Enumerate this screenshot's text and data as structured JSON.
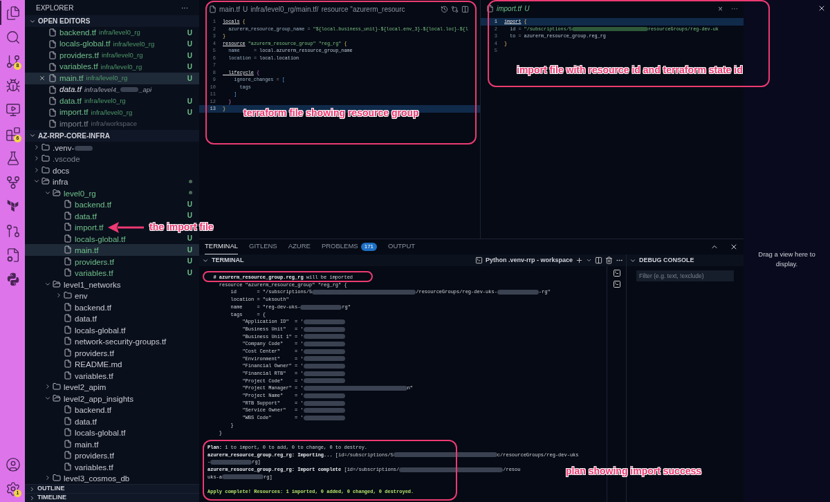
{
  "activity_bar": {
    "items": [
      {
        "kind": "explorer",
        "selected": true
      },
      {
        "kind": "search",
        "selected": false
      },
      {
        "kind": "source-control",
        "selected": false,
        "badge": "8"
      },
      {
        "kind": "run-debug",
        "selected": false
      },
      {
        "kind": "remote",
        "selected": false
      },
      {
        "kind": "extensions",
        "selected": false,
        "badge": "6"
      },
      {
        "kind": "testing",
        "selected": false
      },
      {
        "kind": "git-graph",
        "selected": false
      },
      {
        "kind": "terraform",
        "selected": false
      },
      {
        "kind": "gitlens",
        "selected": false
      },
      {
        "kind": "file-settings",
        "selected": false
      },
      {
        "kind": "python",
        "selected": false
      }
    ],
    "bottom": [
      {
        "kind": "account"
      },
      {
        "kind": "settings",
        "badge": "1"
      }
    ]
  },
  "explorer": {
    "title": "EXPLORER",
    "more": "···",
    "open_editors": {
      "title": "OPEN EDITORS",
      "expanded": true,
      "items": [
        {
          "name": "backend.tf",
          "path": "infra/level0_rg",
          "status": "U",
          "selected": false,
          "preview": false,
          "dimmed": false
        },
        {
          "name": "locals-global.tf",
          "path": "infra/level0_rg",
          "status": "U",
          "selected": false,
          "preview": false,
          "dimmed": false
        },
        {
          "name": "providers.tf",
          "path": "infra/level0_rg",
          "status": "U",
          "selected": false,
          "preview": false,
          "dimmed": false
        },
        {
          "name": "variables.tf",
          "path": "infra/level0_rg",
          "status": "U",
          "selected": false,
          "preview": false,
          "dimmed": false
        },
        {
          "name": "main.tf",
          "path": "infra/level0_rg",
          "status": "U",
          "selected": true,
          "preview": false,
          "dimmed": false
        },
        {
          "name": "data.tf",
          "path": [
            "infra/level4_",
            {
              "kind": "redacted"
            },
            "_api"
          ],
          "selected": false,
          "preview": true,
          "dimmed": false
        },
        {
          "name": "data.tf",
          "path": "infra/level0_rg",
          "status": "U",
          "selected": false,
          "preview": false,
          "dimmed": false
        },
        {
          "name": "import.tf",
          "path": "infra/level0_rg",
          "status": "U",
          "selected": false,
          "preview": false,
          "dimmed": false
        },
        {
          "name": "import.tf",
          "path": "infra/workspace",
          "selected": false,
          "preview": false,
          "dimmed": true
        }
      ]
    },
    "workspace": {
      "title": "AZ-RRP-CORE-INFRA",
      "expanded": true,
      "tree": [
        {
          "kind": "folder",
          "name": [
            ".venv-",
            {
              "kind": "redacted"
            }
          ],
          "expanded": false,
          "dimmed": false
        },
        {
          "kind": "folder",
          "name": ".vscode",
          "expanded": false,
          "dimmed": true
        },
        {
          "kind": "folder",
          "name": "docs",
          "expanded": false,
          "dimmed": false
        },
        {
          "kind": "folder",
          "name": "infra",
          "expanded": true,
          "dimmed": false,
          "has_changes": true,
          "children": [
            {
              "kind": "folder",
              "name": "level0_rg",
              "expanded": true,
              "untracked": true,
              "has_changes": true,
              "children": [
                {
                  "kind": "file",
                  "name": "backend.tf",
                  "status": "U",
                  "selected": false
                },
                {
                  "kind": "file",
                  "name": "data.tf",
                  "status": "U",
                  "selected": false
                },
                {
                  "kind": "file",
                  "name": "import.tf",
                  "untracked": true,
                  "selected": false
                },
                {
                  "kind": "file",
                  "name": "locals-global.tf",
                  "status": "U",
                  "selected": false
                },
                {
                  "kind": "file",
                  "name": "main.tf",
                  "status": "U",
                  "selected": true
                },
                {
                  "kind": "file",
                  "name": "providers.tf",
                  "status": "U",
                  "selected": false
                },
                {
                  "kind": "file",
                  "name": "variables.tf",
                  "status": "U",
                  "selected": false
                }
              ]
            },
            {
              "kind": "folder",
              "name": "level1_networks",
              "expanded": true,
              "children": [
                {
                  "kind": "folder",
                  "name": "env",
                  "expanded": false
                },
                {
                  "kind": "file",
                  "name": "backend.tf",
                  "selected": false
                },
                {
                  "kind": "file",
                  "name": "data.tf",
                  "selected": false
                },
                {
                  "kind": "file",
                  "name": "locals-global.tf",
                  "selected": false
                },
                {
                  "kind": "file",
                  "name": "network-security-groups.tf",
                  "selected": false
                },
                {
                  "kind": "file",
                  "name": "providers.tf",
                  "selected": false
                },
                {
                  "kind": "file",
                  "name": "README.md",
                  "selected": false
                },
                {
                  "kind": "file",
                  "name": "variables.tf",
                  "selected": false
                }
              ]
            },
            {
              "kind": "folder",
              "name": "level2_apim",
              "expanded": false
            },
            {
              "kind": "folder",
              "name": "level2_app_insights",
              "expanded": true,
              "children": [
                {
                  "kind": "file",
                  "name": "backend.tf",
                  "selected": false
                },
                {
                  "kind": "file",
                  "name": "data.tf",
                  "selected": false
                },
                {
                  "kind": "file",
                  "name": "locals-global.tf",
                  "selected": false
                },
                {
                  "kind": "file",
                  "name": "main.tf",
                  "selected": false
                },
                {
                  "kind": "file",
                  "name": "providers.tf",
                  "selected": false
                },
                {
                  "kind": "file",
                  "name": "variables.tf",
                  "selected": false
                }
              ]
            },
            {
              "kind": "folder",
              "name": "level3_cosmos_db",
              "expanded": false
            }
          ]
        }
      ]
    },
    "outline": {
      "title": "OUTLINE",
      "expanded": false
    },
    "timeline": {
      "title": "TIMELINE",
      "expanded": false
    }
  },
  "editors": [
    {
      "tab": {
        "name": "main.tf",
        "status": "U",
        "breadcrumb": "infra/level0_rg/main.tf/",
        "symbol": "resource \"azurerm_resourc"
      },
      "lines": [
        {
          "number": "1",
          "current": false,
          "tokens": [
            {
              "kind": "kw",
              "text": "locals"
            },
            {
              "kind": "y",
              "text": " {"
            }
          ]
        },
        {
          "number": "2",
          "current": false,
          "tokens": [
            {
              "kind": "attr",
              "text": "  azurerm_resource_group_name"
            },
            {
              "kind": "op",
              "text": " = "
            },
            {
              "kind": "str",
              "text": "\"${local.business_unit}-${local.env_3}-${local.loc}-${l"
            }
          ]
        },
        {
          "number": "3",
          "current": false,
          "tokens": [
            {
              "kind": "y",
              "text": "}"
            }
          ]
        },
        {
          "number": "4",
          "current": false,
          "tokens": [
            {
              "kind": "kw",
              "text": "resource"
            },
            {
              "kind": "str",
              "text": " \"azurerm_resource_group\" \"reg_rg\""
            },
            {
              "kind": "y",
              "text": " {"
            }
          ]
        },
        {
          "number": "5",
          "current": false,
          "tokens": [
            {
              "kind": "attr",
              "text": "  name     "
            },
            {
              "kind": "op",
              "text": "= "
            },
            {
              "kind": "id",
              "text": "local.azurerm_resource_group_name"
            }
          ]
        },
        {
          "number": "6",
          "current": false,
          "tokens": [
            {
              "kind": "attr",
              "text": "  location "
            },
            {
              "kind": "op",
              "text": "= "
            },
            {
              "kind": "id",
              "text": "local.location"
            }
          ]
        },
        {
          "number": "7",
          "current": false
        },
        {
          "number": "8",
          "current": false,
          "tokens": [
            {
              "kind": "kw",
              "text": "  lifecycle"
            },
            {
              "kind": "p",
              "text": " {"
            }
          ]
        },
        {
          "number": "9",
          "current": false,
          "tokens": [
            {
              "kind": "attr",
              "text": "    ignore_changes"
            },
            {
              "kind": "op",
              "text": " = "
            },
            {
              "kind": "b",
              "text": "["
            }
          ]
        },
        {
          "number": "10",
          "current": false,
          "tokens": [
            {
              "kind": "attr",
              "text": "      tags"
            }
          ]
        },
        {
          "number": "11",
          "current": false,
          "tokens": [
            {
              "kind": "b",
              "text": "    ]"
            }
          ]
        },
        {
          "number": "12",
          "current": false,
          "tokens": [
            {
              "kind": "p",
              "text": "  }"
            }
          ]
        },
        {
          "number": "13",
          "current": true,
          "tokens": [
            {
              "kind": "y",
              "text": "}"
            }
          ]
        }
      ]
    },
    {
      "tab": {
        "name": "import.tf",
        "status": "U",
        "close": "×",
        "more": "···"
      },
      "lines": [
        {
          "number": "1",
          "current": true,
          "tokens": [
            {
              "kind": "kw",
              "text": "import"
            },
            {
              "kind": "y",
              "text": " {"
            }
          ]
        },
        {
          "number": "2",
          "current": false,
          "tokens": [
            {
              "kind": "attr",
              "text": "  id"
            },
            {
              "kind": "op",
              "text": " = "
            },
            {
              "kind": "str",
              "text": "\"/subscriptions/5"
            },
            {
              "kind": "redacted"
            },
            {
              "kind": "str",
              "text": "resourceGroups/reg-dev-uk"
            }
          ]
        },
        {
          "number": "3",
          "current": false,
          "tokens": [
            {
              "kind": "attr",
              "text": "  to"
            },
            {
              "kind": "op",
              "text": " = "
            },
            {
              "kind": "id",
              "text": "azurerm_resource_group.reg_rg"
            }
          ]
        },
        {
          "number": "4",
          "current": false,
          "tokens": [
            {
              "kind": "y",
              "text": "}"
            }
          ]
        },
        {
          "number": "5",
          "current": false
        }
      ]
    }
  ],
  "panel": {
    "tabs": [
      {
        "label": "TERMINAL",
        "selected": true
      },
      {
        "label": "GITLENS",
        "selected": false
      },
      {
        "label": "AZURE",
        "selected": false
      },
      {
        "label": "PROBLEMS",
        "selected": false,
        "badge": "171"
      },
      {
        "label": "OUTPUT",
        "selected": false
      }
    ],
    "terminal": {
      "title": "TERMINAL",
      "profile": "Python .venv-rrp - workspace",
      "lines": [
        {
          "kind": "text",
          "segments": [
            {
              "kind": "bold",
              "text": "  # azurerm_resource_group.reg_rg"
            },
            {
              "kind": "plain",
              "text": " will be imported"
            }
          ]
        },
        {
          "kind": "text",
          "segments": [
            {
              "kind": "plain",
              "text": "    resource \"azurerm_resource_group\" \"reg_rg\" {"
            }
          ]
        },
        {
          "kind": "text",
          "segments": [
            {
              "kind": "plain",
              "text": "        id       = \"/subscriptions/5"
            },
            {
              "kind": "redacted-long"
            },
            {
              "kind": "plain",
              "text": "/resourceGroups/reg-dev-uks-"
            },
            {
              "kind": "redacted"
            },
            {
              "kind": "plain",
              "text": "-rg\""
            }
          ]
        },
        {
          "kind": "text",
          "segments": [
            {
              "kind": "plain",
              "text": "        location = \"uksouth\""
            }
          ]
        },
        {
          "kind": "text",
          "segments": [
            {
              "kind": "plain",
              "text": "        name     = \"reg-dev-uks-"
            },
            {
              "kind": "redacted"
            },
            {
              "kind": "plain",
              "text": "rg\""
            }
          ]
        },
        {
          "kind": "text",
          "segments": [
            {
              "kind": "plain",
              "text": "        tags     = {"
            }
          ]
        },
        {
          "kind": "text",
          "segments": [
            {
              "kind": "plain",
              "text": "            \"Application ID\"  = '"
            },
            {
              "kind": "redacted"
            }
          ]
        },
        {
          "kind": "text",
          "segments": [
            {
              "kind": "plain",
              "text": "            \"Business Unit\"   = '"
            },
            {
              "kind": "redacted"
            }
          ]
        },
        {
          "kind": "text",
          "segments": [
            {
              "kind": "plain",
              "text": "            \"Business Unit 1\" = '"
            },
            {
              "kind": "redacted"
            }
          ]
        },
        {
          "kind": "text",
          "segments": [
            {
              "kind": "plain",
              "text": "            \"Company Code\"    = '"
            },
            {
              "kind": "redacted"
            }
          ]
        },
        {
          "kind": "text",
          "segments": [
            {
              "kind": "plain",
              "text": "            \"Cost Center\"     = '"
            },
            {
              "kind": "redacted"
            }
          ]
        },
        {
          "kind": "text",
          "segments": [
            {
              "kind": "plain",
              "text": "            \"Environment\"     = '"
            },
            {
              "kind": "redacted"
            }
          ]
        },
        {
          "kind": "text",
          "segments": [
            {
              "kind": "plain",
              "text": "            \"Financial Owner\" = '"
            },
            {
              "kind": "redacted"
            }
          ]
        },
        {
          "kind": "text",
          "segments": [
            {
              "kind": "plain",
              "text": "            \"Financial RTB\"   = '"
            },
            {
              "kind": "redacted"
            }
          ]
        },
        {
          "kind": "text",
          "segments": [
            {
              "kind": "plain",
              "text": "            \"Project Code\"    = '"
            },
            {
              "kind": "redacted"
            }
          ]
        },
        {
          "kind": "text",
          "segments": [
            {
              "kind": "plain",
              "text": "            \"Project Manager\" = '"
            },
            {
              "kind": "redacted-long"
            },
            {
              "kind": "plain",
              "text": "n\""
            }
          ]
        },
        {
          "kind": "text",
          "segments": [
            {
              "kind": "plain",
              "text": "            \"Project Name\"    = '"
            },
            {
              "kind": "redacted"
            }
          ]
        },
        {
          "kind": "text",
          "segments": [
            {
              "kind": "plain",
              "text": "            \"RTB Support\"     = '"
            },
            {
              "kind": "redacted"
            }
          ]
        },
        {
          "kind": "text",
          "segments": [
            {
              "kind": "plain",
              "text": "            \"Service Owner\"   = '"
            },
            {
              "kind": "redacted"
            }
          ]
        },
        {
          "kind": "text",
          "segments": [
            {
              "kind": "plain",
              "text": "            \"WBS Code\"        = '"
            },
            {
              "kind": "redacted"
            }
          ]
        },
        {
          "kind": "text",
          "segments": [
            {
              "kind": "plain",
              "text": "        }"
            }
          ]
        },
        {
          "kind": "text",
          "segments": [
            {
              "kind": "plain",
              "text": "    }"
            }
          ]
        },
        {
          "kind": "blank"
        },
        {
          "kind": "text",
          "segments": [
            {
              "kind": "bold",
              "text": "Plan:"
            },
            {
              "kind": "plain",
              "text": " 1 to import, 0 to add, 0 to change, 0 to destroy."
            }
          ]
        },
        {
          "kind": "text",
          "segments": [
            {
              "kind": "bold",
              "text": "azurerm_resource_group.reg_rg: Importing..."
            },
            {
              "kind": "plain",
              "text": " [id=/subscriptions/5"
            },
            {
              "kind": "redacted-long"
            },
            {
              "kind": "plain",
              "text": "c/resourceGroups/reg-dev-uks"
            }
          ]
        },
        {
          "kind": "text",
          "segments": [
            {
              "kind": "plain",
              "text": "-"
            },
            {
              "kind": "redacted"
            },
            {
              "kind": "plain",
              "text": "rg]"
            }
          ]
        },
        {
          "kind": "text",
          "segments": [
            {
              "kind": "bold",
              "text": "azurerm_resource_group.reg_rg: Import complete"
            },
            {
              "kind": "plain",
              "text": " [id=/subscriptions/"
            },
            {
              "kind": "redacted-long"
            },
            {
              "kind": "plain",
              "text": "/resou"
            }
          ]
        },
        {
          "kind": "text",
          "segments": [
            {
              "kind": "plain",
              "text": "uks-a"
            },
            {
              "kind": "redacted"
            },
            {
              "kind": "plain",
              "text": "rg]"
            }
          ]
        },
        {
          "kind": "blank"
        },
        {
          "kind": "text",
          "segments": [
            {
              "kind": "success",
              "text": "Apply complete! Resources: 1 imported, 0 added, 0 changed, 0 destroyed."
            }
          ]
        }
      ]
    },
    "debug_console": {
      "title": "DEBUG CONSOLE",
      "filter_placeholder": "Filter (e.g. text, !exclude)"
    }
  },
  "empty_view": {
    "message": "Drag a view here to display."
  },
  "annotations": [
    {
      "kind": "box",
      "text": "terraform file showing resource group"
    },
    {
      "kind": "box",
      "text": "import file with resource id and terraform state id"
    },
    {
      "kind": "arrow",
      "text": "the import file"
    },
    {
      "kind": "box"
    },
    {
      "kind": "box",
      "text": "plan showing import success"
    }
  ]
}
